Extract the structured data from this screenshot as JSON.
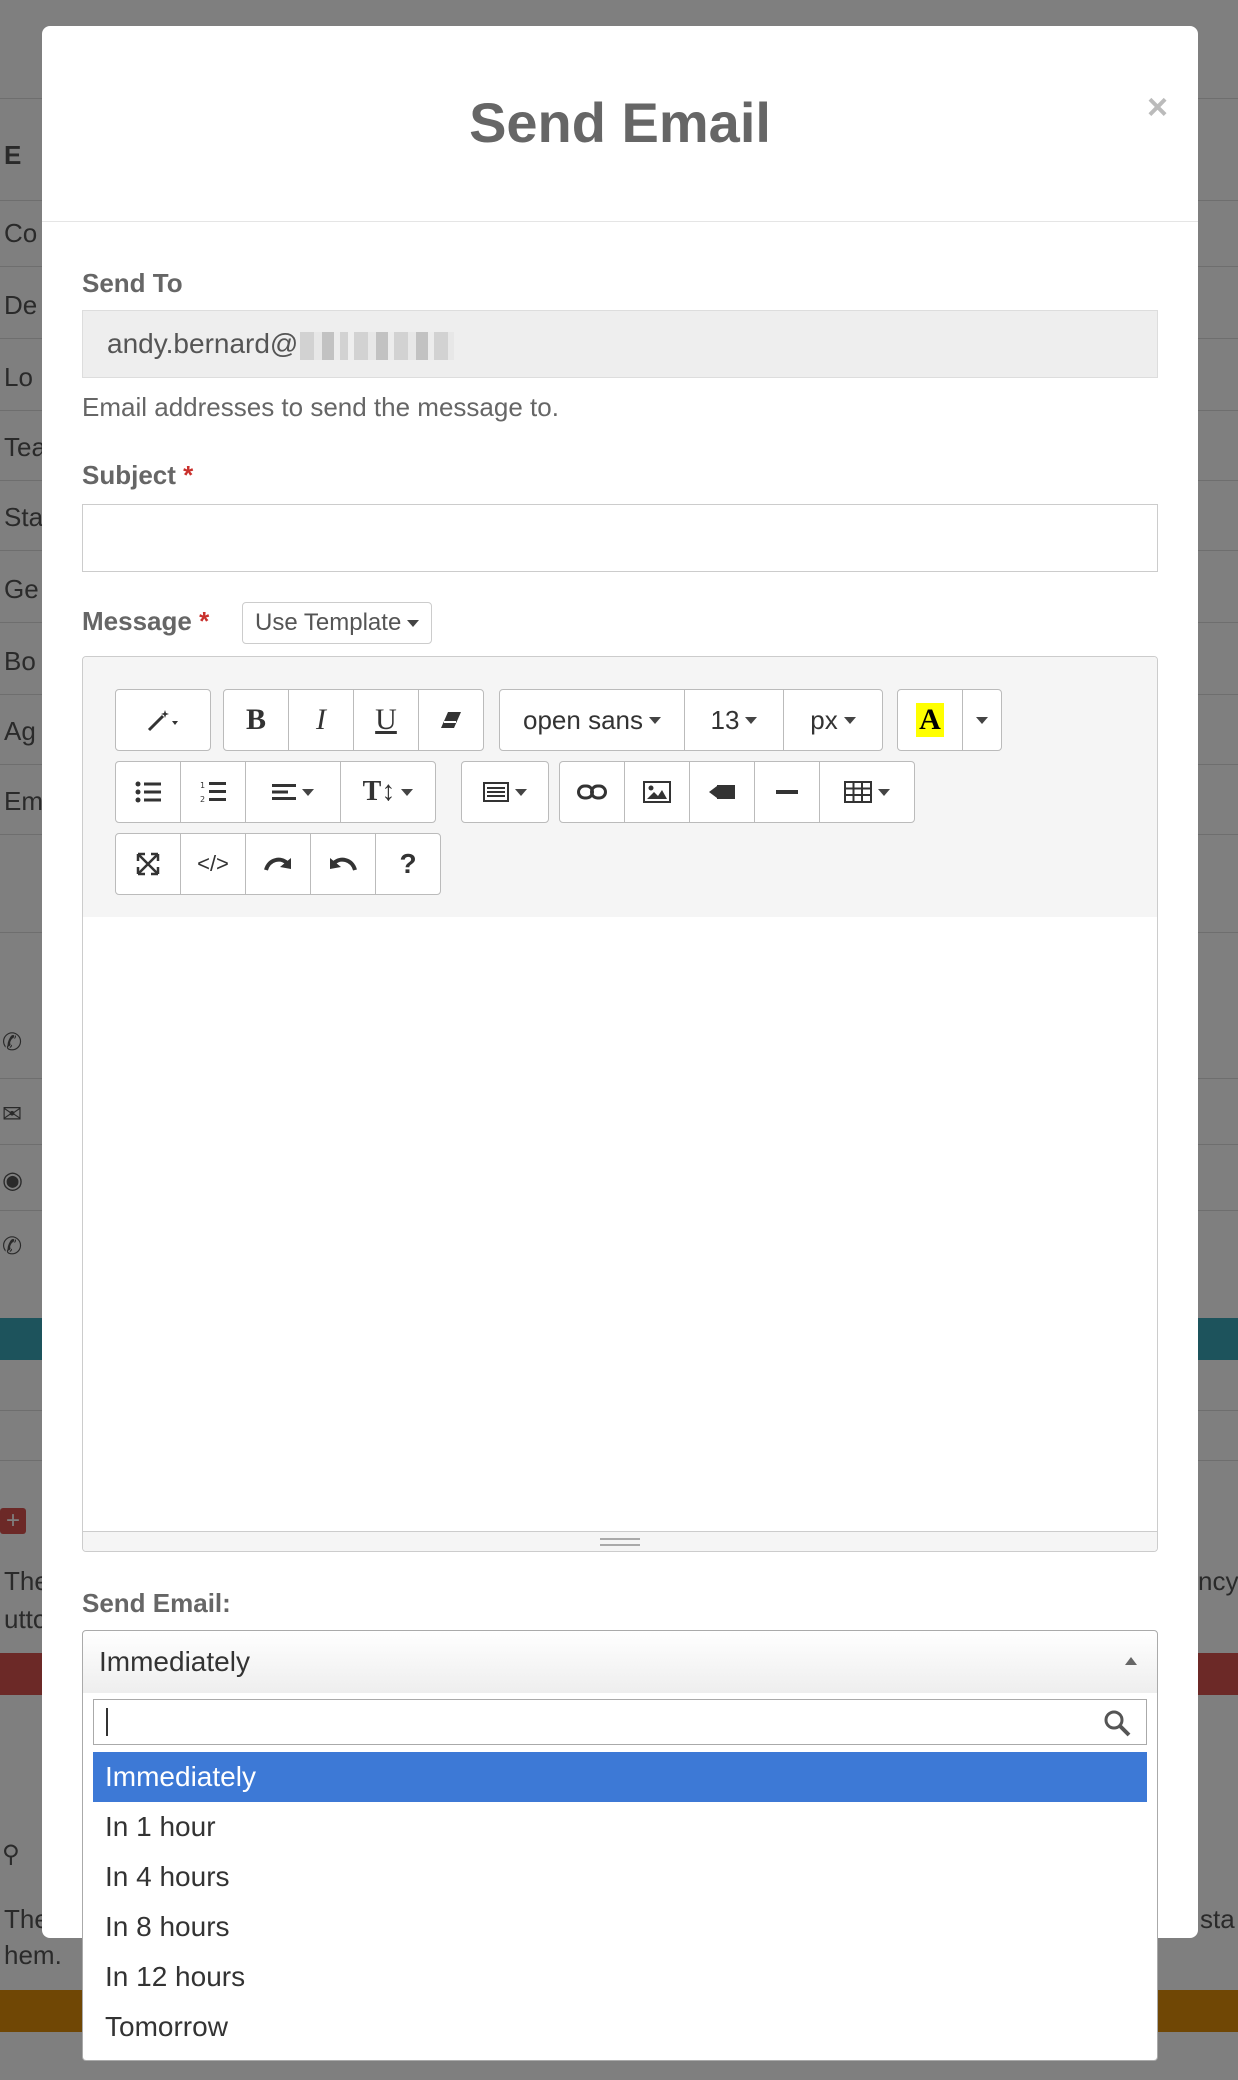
{
  "modal": {
    "title": "Send Email",
    "close_label": "×"
  },
  "send_to": {
    "label": "Send To",
    "value": "andy.bernard@",
    "help": "Email addresses to send the message to."
  },
  "subject": {
    "label": "Subject",
    "required_mark": "*",
    "value": ""
  },
  "message": {
    "label": "Message",
    "required_mark": "*",
    "template_button": "Use Template"
  },
  "toolbar": {
    "font_name": "open sans",
    "font_size": "13",
    "font_unit": "px",
    "color_letter": "A",
    "code_label": "</>",
    "help_label": "?"
  },
  "send_email": {
    "label": "Send Email:",
    "selected": "Immediately",
    "search_value": "",
    "options": [
      "Immediately",
      "In 1 hour",
      "In 4 hours",
      "In 8 hours",
      "In 12 hours",
      "Tomorrow"
    ]
  },
  "background": {
    "labels": [
      "Co",
      "De",
      "Lo",
      "Tea",
      "Sta",
      "Ge",
      "Bo",
      "Ag",
      "Em"
    ],
    "snippet_1": "Ther",
    "snippet_2": "utto",
    "snippet_3": "ncy",
    "snippet_4": "Ther",
    "snippet_5": "hem.",
    "snippet_6": "sta"
  },
  "colors": {
    "selected_option": "#3d79d6",
    "required": "#c9302c",
    "teal_bar": "#3aa6b9",
    "red_bar": "#d9534f",
    "orange_bar": "#e08e0b"
  }
}
